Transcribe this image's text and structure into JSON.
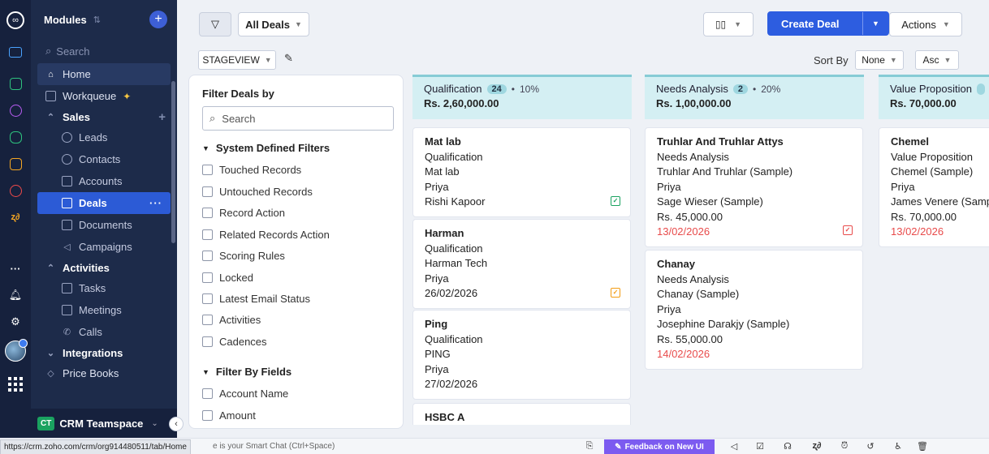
{
  "sidebar": {
    "title": "Modules",
    "search_placeholder": "Search",
    "home": "Home",
    "workqueue": "Workqueue",
    "sales": "Sales",
    "leads": "Leads",
    "contacts": "Contacts",
    "accounts": "Accounts",
    "deals": "Deals",
    "documents": "Documents",
    "campaigns": "Campaigns",
    "activities": "Activities",
    "tasks": "Tasks",
    "meetings": "Meetings",
    "calls": "Calls",
    "integrations": "Integrations",
    "price_books": "Price Books",
    "team_badge": "CT",
    "team_name": "CRM Teamspace"
  },
  "toolbar": {
    "view": "All Deals",
    "create": "Create Deal",
    "actions": "Actions",
    "stageview": "STAGEVIEW",
    "sort_by": "Sort By",
    "sort_field": "None",
    "sort_order": "Asc"
  },
  "filters": {
    "title": "Filter Deals by",
    "search_placeholder": "Search",
    "system_title": "System Defined Filters",
    "system": [
      "Touched Records",
      "Untouched Records",
      "Record Action",
      "Related Records Action",
      "Scoring Rules",
      "Locked",
      "Latest Email Status",
      "Activities",
      "Cadences"
    ],
    "fields_title": "Filter By Fields",
    "fields": [
      "Account Name",
      "Amount"
    ]
  },
  "columns": [
    {
      "stage": "Qualification",
      "count": "24",
      "pct": "10%",
      "amount": "Rs. 2,60,000.00",
      "cards": [
        {
          "lines": [
            "Mat lab",
            "Qualification",
            "Mat lab",
            "Priya",
            "Rishi Kapoor"
          ]
        },
        {
          "lines": [
            "Harman",
            "Qualification",
            "Harman Tech",
            "Priya",
            "26/02/2026"
          ]
        },
        {
          "lines": [
            "Ping",
            "Qualification",
            "PING",
            "Priya",
            "27/02/2026"
          ]
        },
        {
          "lines": [
            "HSBC A"
          ]
        }
      ]
    },
    {
      "stage": "Needs Analysis",
      "count": "2",
      "pct": "20%",
      "amount": "Rs. 1,00,000.00",
      "cards": [
        {
          "lines": [
            "Truhlar And Truhlar Attys",
            "Needs Analysis",
            "Truhlar And Truhlar (Sample)",
            "Priya",
            "Sage Wieser (Sample)",
            "Rs. 45,000.00",
            "13/02/2026"
          ]
        },
        {
          "lines": [
            "Chanay",
            "Needs Analysis",
            "Chanay (Sample)",
            "Priya",
            "Josephine Darakjy (Sample)",
            "Rs. 55,000.00",
            "14/02/2026"
          ]
        }
      ]
    },
    {
      "stage": "Value Proposition",
      "amount": "Rs. 70,000.00",
      "cards": [
        {
          "lines": [
            "Chemel",
            "Value Proposition",
            "Chemel (Sample)",
            "Priya",
            "James Venere (Sample)",
            "Rs. 70,000.00",
            "13/02/2026"
          ]
        }
      ]
    }
  ],
  "status": {
    "url": "https://crm.zoho.com/crm/org914480511/tab/Home",
    "hint": "e is your Smart Chat (Ctrl+Space)",
    "feedback": "Feedback on New UI"
  }
}
